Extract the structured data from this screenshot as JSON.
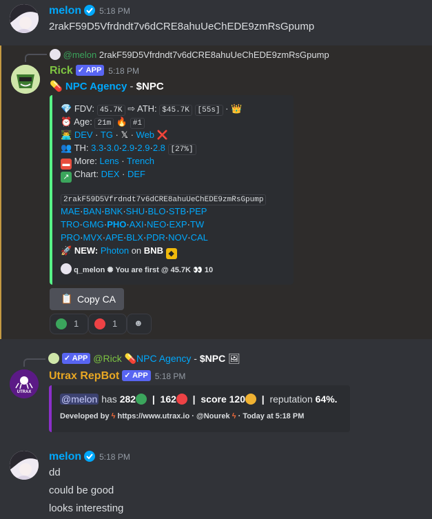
{
  "msg1": {
    "author": "melon",
    "time": "5:18 PM",
    "text": "2rakF59D5Vfrdndt7v6dCRE8ahuUeChEDE9zmRsGpump"
  },
  "msg2": {
    "reply_user": "@melon",
    "reply_text": "2rakF59D5Vfrdndt7v6dCRE8ahuUeChEDE9zmRsGpump",
    "author": "Rick",
    "app_tag": "APP",
    "time": "5:18 PM",
    "token_name": "NPC Agency",
    "dash": " - ",
    "ticker": "$NPC",
    "embed": {
      "fdv_label": "FDV:",
      "fdv_val": "45.7K",
      "ath_label": "⇨ ATH:",
      "ath_val": "$45.7K",
      "ath_age": "[55s]",
      "age_label": "Age:",
      "age_val": "21m",
      "rank": "#1",
      "dev": "DEV",
      "tg": "TG",
      "x": "𝕏",
      "web": "Web",
      "th_label": "TH:",
      "th_vals": [
        "3.3",
        "3.0",
        "2.9",
        "2.9",
        "2.8"
      ],
      "th_pct": "[27%]",
      "more_label": "More:",
      "lens": "Lens",
      "trench": "Trench",
      "chart_label": "Chart:",
      "dex": "DEX",
      "def": "DEF",
      "ca": "2rakF59D5Vfrdndt7v6dCRE8ahuUeChEDE9zmRsGpump",
      "row1": [
        "MAE",
        "BAN",
        "BNK",
        "SHU",
        "BLO",
        "STB",
        "PEP"
      ],
      "row2": [
        "TRO",
        "GMG",
        "PHO",
        "AXI",
        "NEO",
        "EXP",
        "TW"
      ],
      "row3": [
        "PRO",
        "MVX",
        "APE",
        "BLX",
        "PDR",
        "NOV",
        "CAL"
      ],
      "new_label": "NEW:",
      "photon": "Photon",
      "on": "on",
      "bnb": "BNB",
      "footer_user": "q_melon",
      "footer_text": "You are first @ 45.7K",
      "footer_count": "10"
    },
    "copy_button": "Copy CA",
    "reactions": [
      {
        "color": "#3ba55c",
        "count": "1"
      },
      {
        "color": "#ed4245",
        "count": "1"
      }
    ]
  },
  "msg3": {
    "reply_tag": "APP",
    "reply_user": "@Rick",
    "reply_title": "NPC Agency",
    "reply_dash": " - ",
    "reply_ticker": "$NPC",
    "author": "Utrax RepBot",
    "app_tag": "APP",
    "time": "5:18 PM",
    "avatar_label": "UTRAX",
    "embed": {
      "mention": "@melon",
      "has": "has",
      "pos": "282",
      "neg": "162",
      "score_label": "score",
      "score": "120",
      "rep_label": "reputation",
      "rep": "64%.",
      "dev_by": "Developed by",
      "url": "https://www.utrax.io",
      "dot": "·",
      "author": "@Nourek",
      "today": "Today at 5:18 PM"
    }
  },
  "msg4": {
    "author": "melon",
    "time": "5:18 PM",
    "lines": [
      "dd",
      "could be good",
      "looks interesting"
    ]
  },
  "colors": {
    "green": "#3ba55c",
    "red": "#ed4245",
    "link": "#00a8fc",
    "purple": "#8b2fc9",
    "embed_bar": "#57f287"
  }
}
